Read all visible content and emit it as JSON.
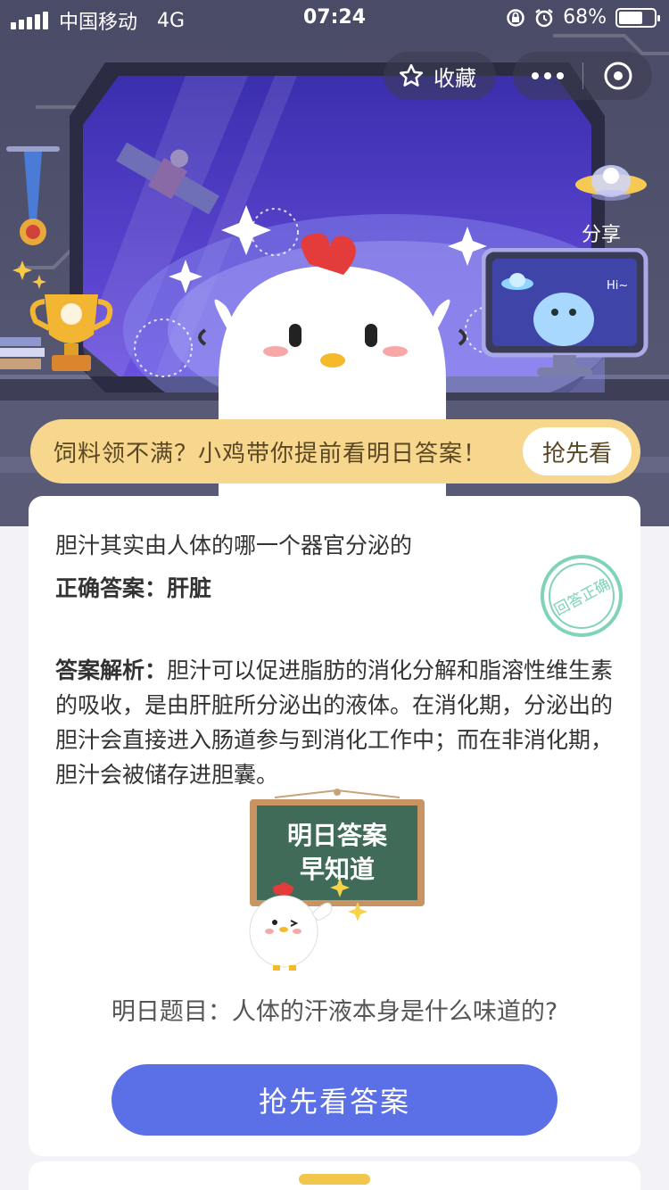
{
  "status_bar": {
    "carrier": "中国移动",
    "network": "4G",
    "time": "07:24",
    "battery_percent": "68%",
    "battery_level": 0.68
  },
  "top_actions": {
    "favorite_label": "收藏",
    "share_label": "分享",
    "icons": [
      "star-icon",
      "more-dots-icon",
      "close-target-icon"
    ]
  },
  "scene": {
    "monitor_greeting": "Hi~"
  },
  "banner": {
    "text": "饲料领不满？小鸡带你提前看明日答案！",
    "button_label": "抢先看"
  },
  "card": {
    "question": "胆汁其实由人体的哪一个器官分泌的",
    "answer_label": "正确答案：",
    "answer_value": "肝脏",
    "stamp_text": "回答正确",
    "analysis_label": "答案解析：",
    "analysis_text": "胆汁可以促进脂肪的消化分解和脂溶性维生素的吸收，是由肝脏所分泌出的液体。在消化期，分泌出的胆汁会直接进入肠道参与到消化工作中；而在非消化期，胆汁会被储存进胆囊。",
    "board_line1": "明日答案",
    "board_line2": "早知道",
    "tomorrow_question": "明日题目：人体的汗液本身是什么味道的?",
    "cta_label": "抢先看答案"
  },
  "colors": {
    "primary": "#5b6fe6",
    "banner_bg": "#f7d78d",
    "stamp": "#7fd3b8",
    "window_sky": "#4b3fc8"
  }
}
